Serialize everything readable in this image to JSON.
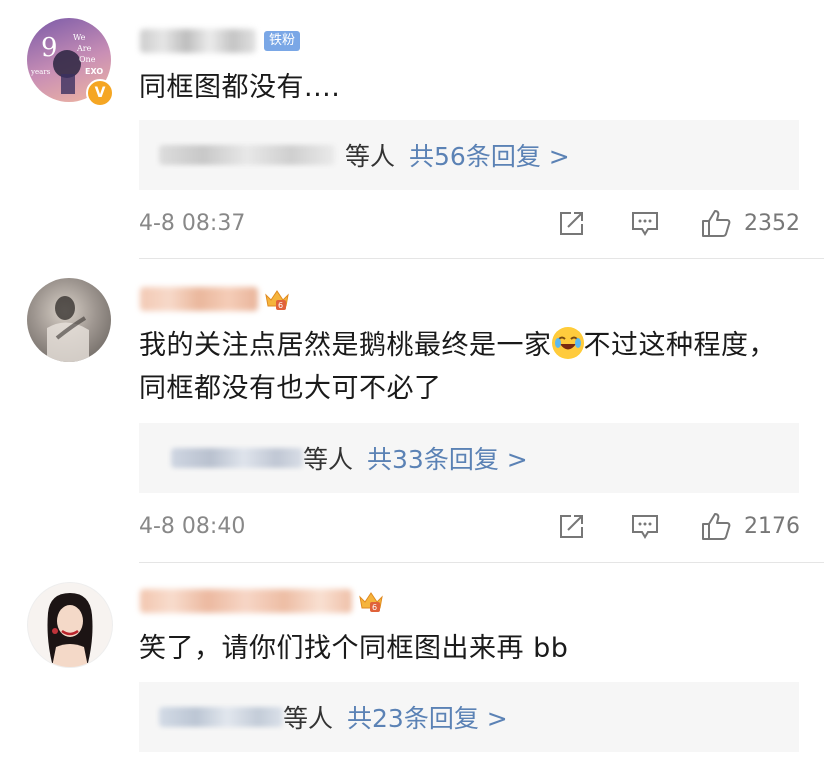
{
  "comments": [
    {
      "badge": "铁粉",
      "text": "同框图都没有....",
      "reply_suffix": "等人",
      "reply_count": "共56条回复 >",
      "time": "4-8 08:37",
      "likes": "2352"
    },
    {
      "text": "我的关注点居然是鹅桃最终是一家",
      "text2": "不过这种程度，同框都没有也大可不必了",
      "reply_suffix": "等人",
      "reply_count": "共33条回复 >",
      "time": "4-8 08:40",
      "likes": "2176"
    },
    {
      "text": "笑了，请你们找个同框图出来再 bb",
      "reply_suffix": "等人",
      "reply_count": "共23条回复 >"
    }
  ],
  "avatar1": {
    "text_lines": [
      "We",
      "Are",
      "One"
    ],
    "side_text": "years",
    "tag": "EXO",
    "number": "9"
  },
  "icons": [
    "share-icon",
    "comment-icon",
    "like-icon",
    "crown-icon",
    "laugh-emoji-icon",
    "verified-icon"
  ],
  "colors": {
    "link": "#5b82b5",
    "reply_bg": "#f6f6f6",
    "fan_badge": "#7aa7e6",
    "verified": "#f5a623"
  }
}
